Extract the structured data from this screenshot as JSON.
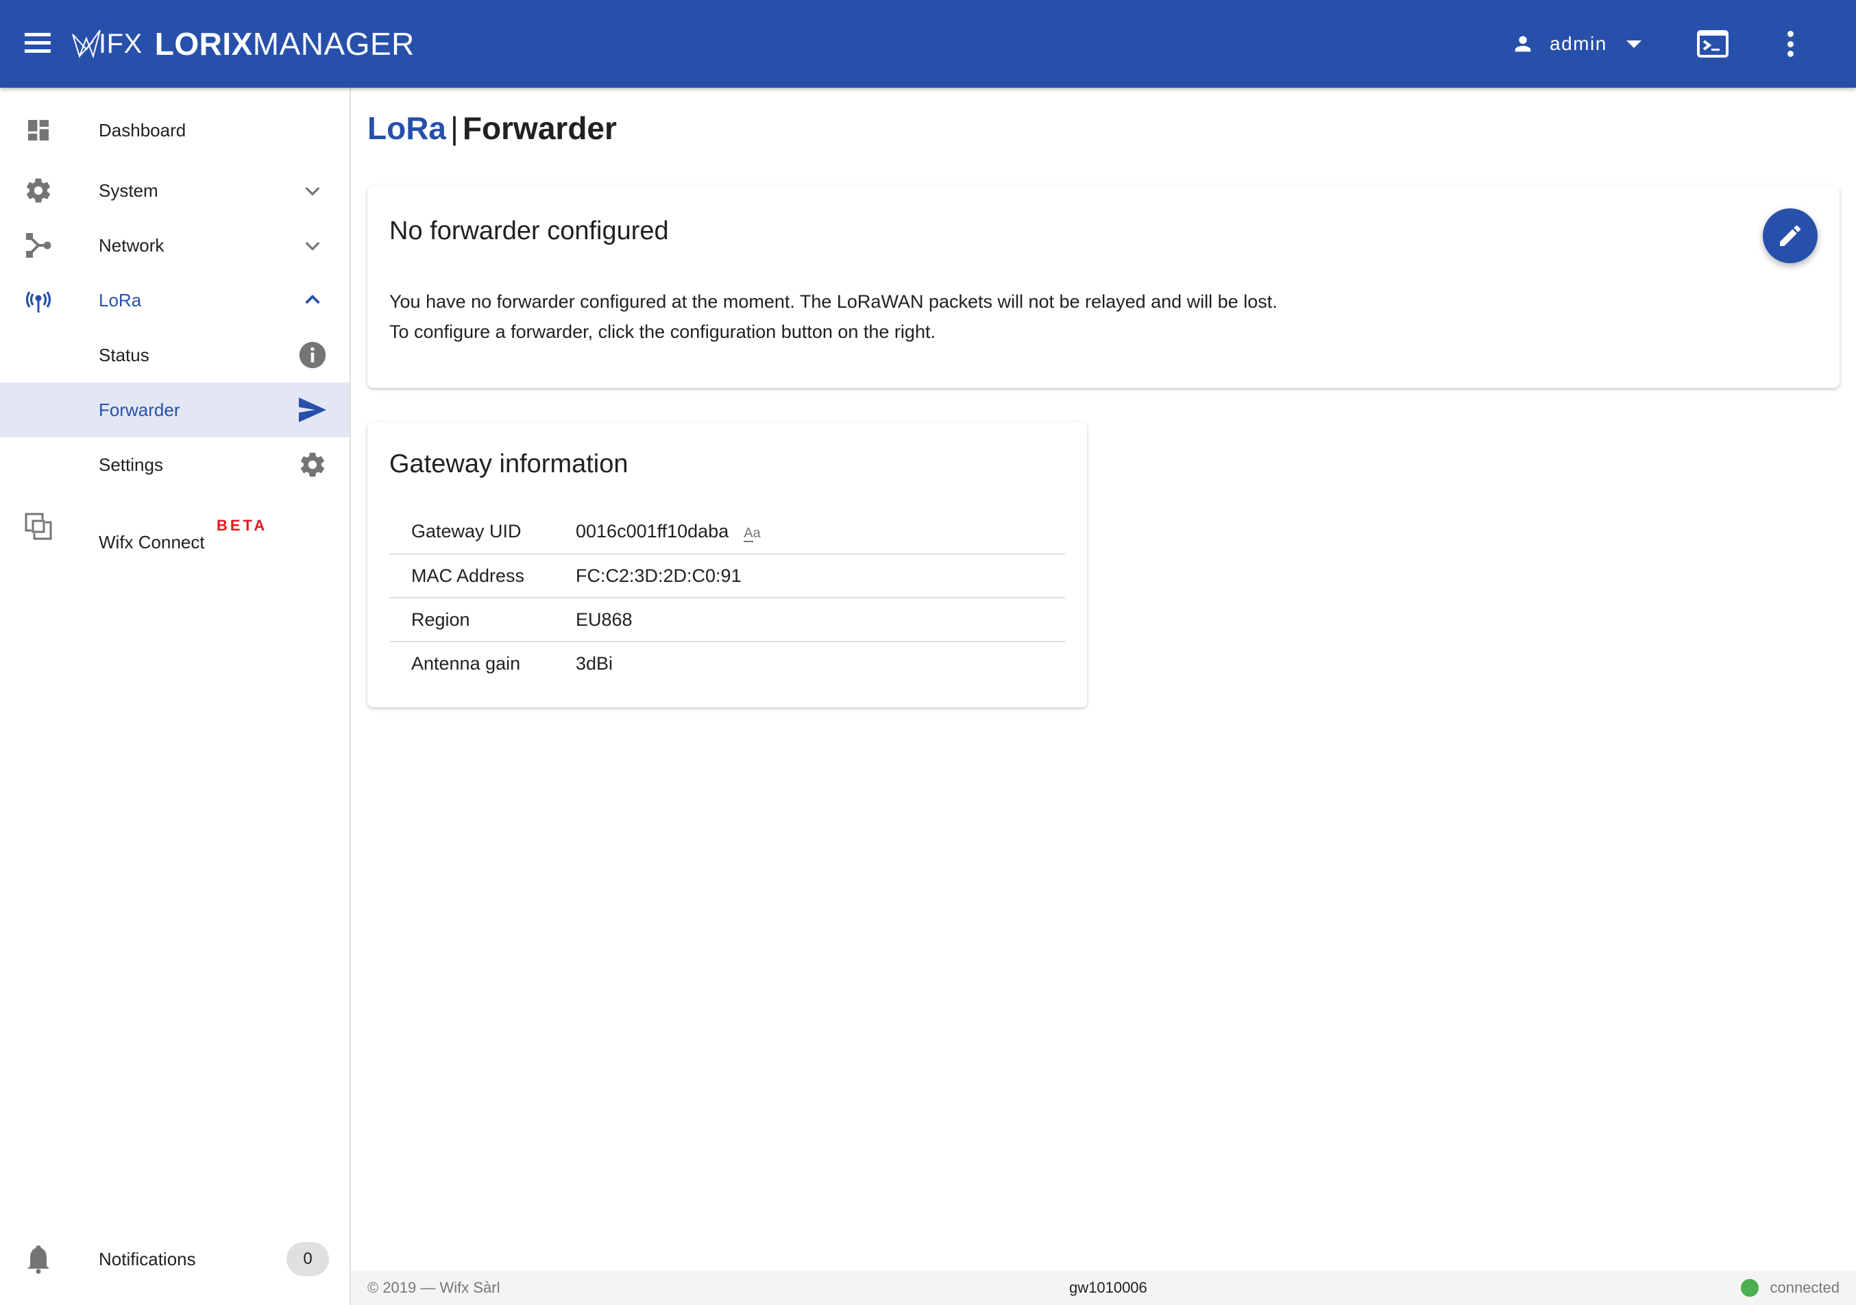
{
  "appbar": {
    "brand_wifx": "IFX",
    "brand_lorix": "LORIX",
    "brand_manager": "MANAGER",
    "user_name": "admin",
    "icons": {
      "menu": "hamburger-menu-icon",
      "user": "person-icon",
      "dropdown": "caret-down-icon",
      "terminal": "terminal-icon",
      "more": "more-vertical-icon"
    },
    "color": "#2750ab"
  },
  "sidebar": {
    "items": [
      {
        "label": "Dashboard",
        "icon": "dashboard-icon"
      },
      {
        "label": "System",
        "icon": "gear-icon",
        "expanded": false
      },
      {
        "label": "Network",
        "icon": "network-hub-icon",
        "expanded": false
      },
      {
        "label": "LoRa",
        "icon": "antenna-icon",
        "expanded": true,
        "children": [
          {
            "label": "Status",
            "icon": "info-icon"
          },
          {
            "label": "Forwarder",
            "icon": "send-icon",
            "selected": true
          },
          {
            "label": "Settings",
            "icon": "gear-icon"
          }
        ]
      },
      {
        "label": "Wifx Connect",
        "icon": "connect-icon",
        "badge": "BETA"
      }
    ],
    "notifications": {
      "label": "Notifications",
      "count": "0",
      "icon": "bell-icon"
    }
  },
  "page": {
    "breadcrumb_section": "LoRa",
    "separator": "|",
    "title": "Forwarder"
  },
  "forwarder_card": {
    "title": "No forwarder configured",
    "line1": "You have no forwarder configured at the moment. The LoRaWAN packets will not be relayed and will be lost.",
    "line2": "To configure a forwarder, click the configuration button on the right.",
    "edit_icon": "pencil-icon"
  },
  "gateway_card": {
    "title": "Gateway information",
    "rows": [
      {
        "key": "Gateway UID",
        "value": "0016c001ff10daba",
        "toggle": "Aa"
      },
      {
        "key": "MAC Address",
        "value": "FC:C2:3D:2D:C0:91"
      },
      {
        "key": "Region",
        "value": "EU868"
      },
      {
        "key": "Antenna gain",
        "value": "3dBi"
      }
    ]
  },
  "footer": {
    "copyright": "© 2019 — Wifx Sàrl",
    "hostname": "gw1010006",
    "status": "connected",
    "status_color": "#4caf50"
  }
}
